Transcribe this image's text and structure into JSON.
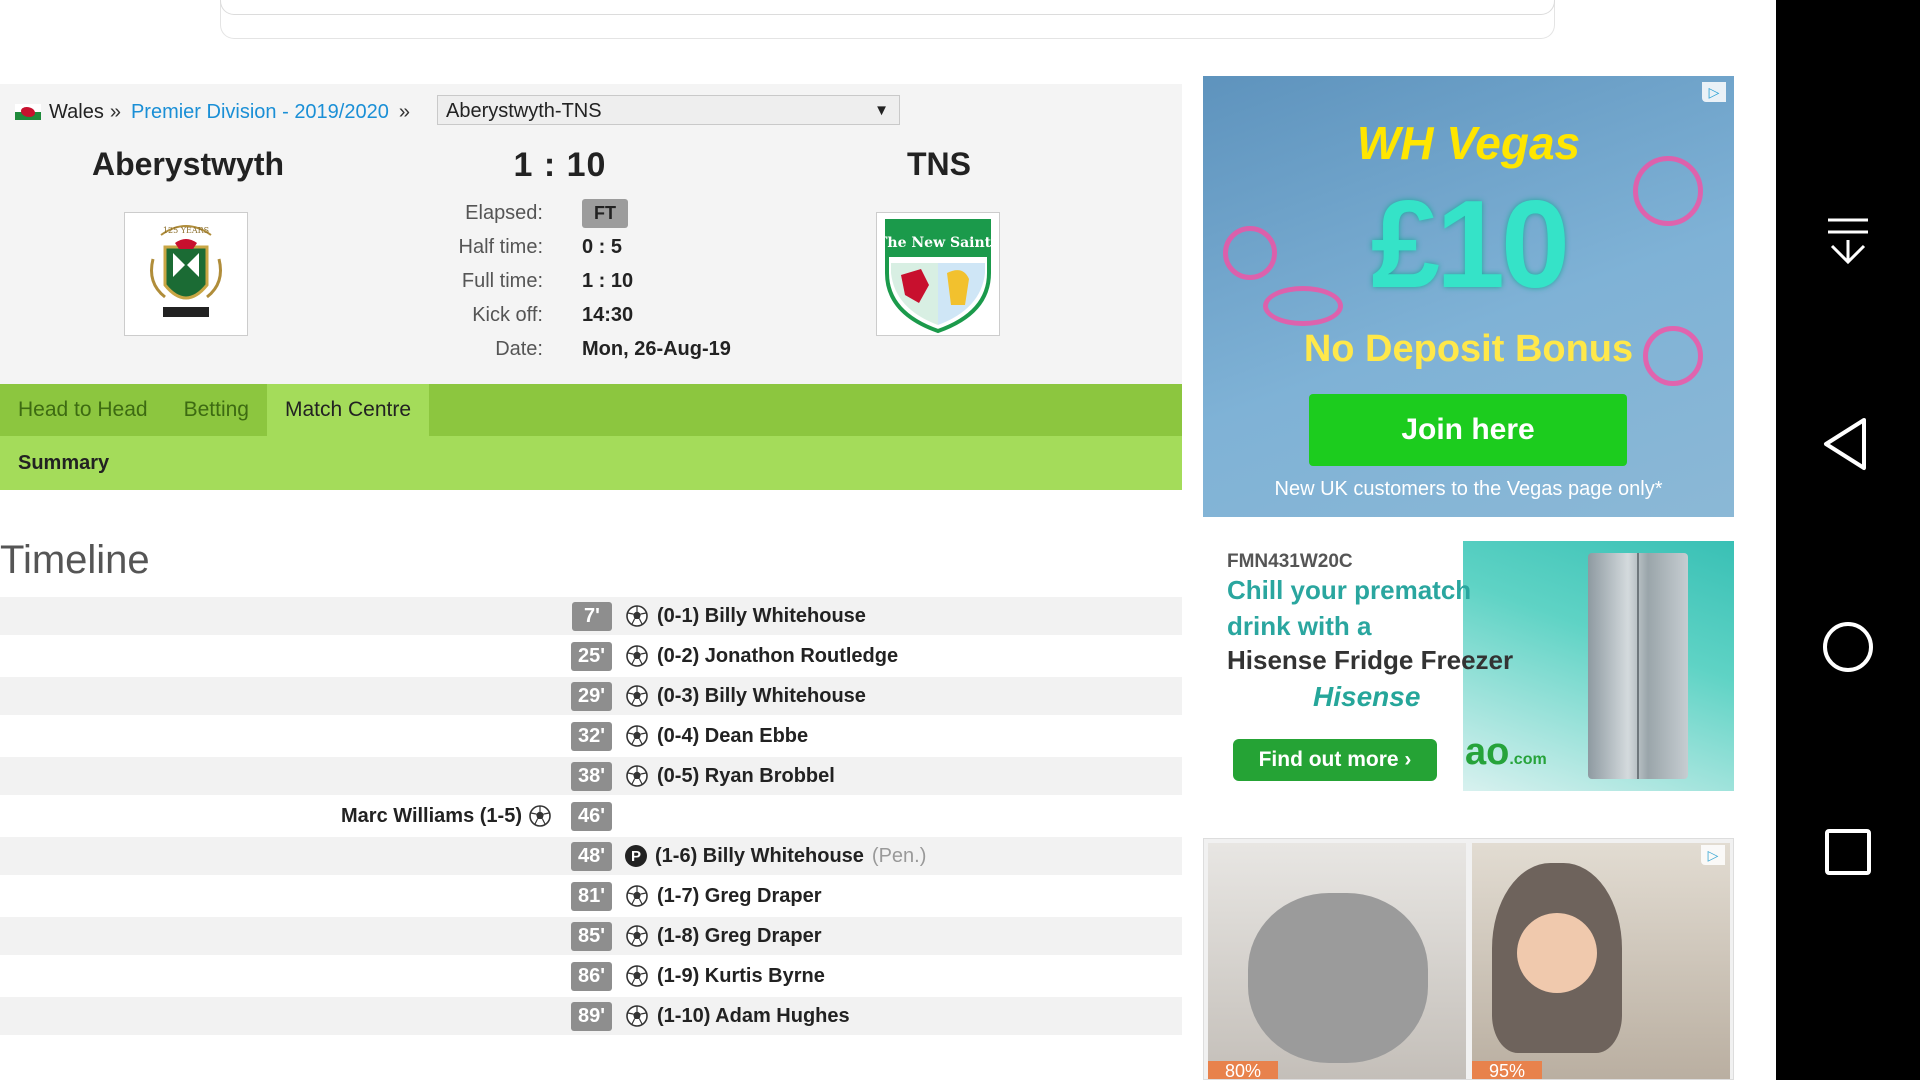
{
  "breadcrumb": {
    "country": "Wales",
    "sep1": "»",
    "league": "Premier Division - 2019/2020",
    "sep2": "»"
  },
  "match_select": {
    "value": "Aberystwyth-TNS",
    "arrow": "▼"
  },
  "match": {
    "home_team": "Aberystwyth",
    "away_team": "TNS",
    "score": "1 : 10",
    "info": [
      {
        "label": "Elapsed:",
        "value": "FT"
      },
      {
        "label": "Half time:",
        "value": "0 : 5"
      },
      {
        "label": "Full time:",
        "value": "1 : 10"
      },
      {
        "label": "Kick off:",
        "value": "14:30"
      },
      {
        "label": "Date:",
        "value": "Mon, 26-Aug-19"
      }
    ],
    "home_crest_text": "125 YEARS",
    "away_crest_text": "The New Saints"
  },
  "tabs": [
    "Head to Head",
    "Betting",
    "Match Centre"
  ],
  "subtabs": [
    "Summary"
  ],
  "timeline": {
    "title": "Timeline",
    "events": [
      {
        "minute": "7'",
        "side": "away",
        "text": "(0-1) Billy Whitehouse",
        "type": "goal"
      },
      {
        "minute": "25'",
        "side": "away",
        "text": "(0-2) Jonathon Routledge",
        "type": "goal"
      },
      {
        "minute": "29'",
        "side": "away",
        "text": "(0-3) Billy Whitehouse",
        "type": "goal"
      },
      {
        "minute": "32'",
        "side": "away",
        "text": "(0-4) Dean Ebbe",
        "type": "goal"
      },
      {
        "minute": "38'",
        "side": "away",
        "text": "(0-5) Ryan Brobbel",
        "type": "goal"
      },
      {
        "minute": "46'",
        "side": "home",
        "text": "Marc Williams (1-5)",
        "type": "goal"
      },
      {
        "minute": "48'",
        "side": "away",
        "text": "(1-6) Billy Whitehouse",
        "type": "penalty",
        "extra": "(Pen.)",
        "pen_glyph": "P"
      },
      {
        "minute": "81'",
        "side": "away",
        "text": "(1-7) Greg Draper",
        "type": "goal"
      },
      {
        "minute": "85'",
        "side": "away",
        "text": "(1-8) Greg Draper",
        "type": "goal"
      },
      {
        "minute": "86'",
        "side": "away",
        "text": "(1-9) Kurtis Byrne",
        "type": "goal"
      },
      {
        "minute": "89'",
        "side": "away",
        "text": "(1-10) Adam Hughes",
        "type": "goal"
      }
    ]
  },
  "ads": {
    "vegas": {
      "logo": "WH Vegas",
      "amount": "£10",
      "headline": "No Deposit Bonus",
      "cta": "Join here",
      "disclaimer": "New UK customers to the Vegas page only*",
      "adchoice": "▷"
    },
    "hisense": {
      "code": "FMN431W20C",
      "line1": "Chill your prematch",
      "line2": "drink with a",
      "line3": "Hisense Fridge Freezer",
      "brand": "Hisense",
      "cta": "Find out more ›",
      "ao": "ao",
      "ao_suffix": ".com"
    },
    "baby": {
      "badge1": "80%",
      "badge2": "95%",
      "adchoice": "▷"
    }
  },
  "colors": {
    "link": "#1a8fd6",
    "tab_bar": "#8cc63f",
    "tab_active": "#a4dc5a",
    "minute_badge": "#8e8e8e"
  }
}
